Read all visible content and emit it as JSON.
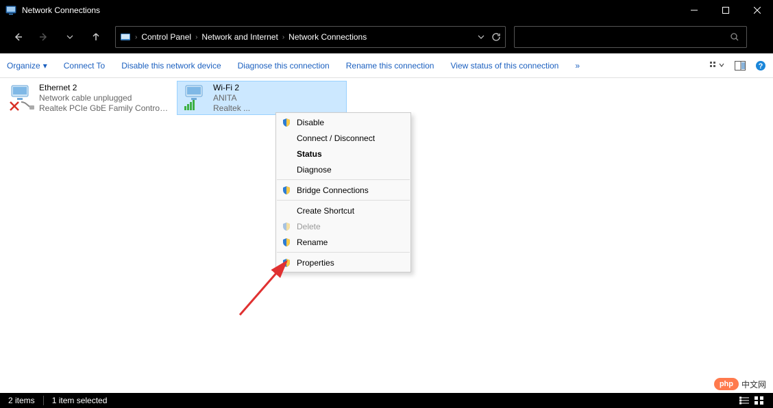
{
  "window": {
    "title": "Network Connections"
  },
  "breadcrumbs": [
    "Control Panel",
    "Network and Internet",
    "Network Connections"
  ],
  "toolbar": {
    "organize": "Organize",
    "items": [
      "Connect To",
      "Disable this network device",
      "Diagnose this connection",
      "Rename this connection",
      "View status of this connection"
    ],
    "overflow": "»"
  },
  "connections": [
    {
      "name": "Ethernet 2",
      "status": "Network cable unplugged",
      "device": "Realtek PCIe GbE Family Controller",
      "selected": false,
      "type": "ethernet"
    },
    {
      "name": "Wi-Fi 2",
      "status": "ANITA",
      "device": "Realtek ...",
      "selected": true,
      "type": "wifi"
    }
  ],
  "context_menu": [
    {
      "label": "Disable",
      "shield": true
    },
    {
      "label": "Connect / Disconnect"
    },
    {
      "label": "Status",
      "bold": true
    },
    {
      "label": "Diagnose"
    },
    {
      "sep": true
    },
    {
      "label": "Bridge Connections",
      "shield": true
    },
    {
      "sep": true
    },
    {
      "label": "Create Shortcut"
    },
    {
      "label": "Delete",
      "shield": true,
      "disabled": true
    },
    {
      "label": "Rename",
      "shield": true
    },
    {
      "sep": true
    },
    {
      "label": "Properties",
      "shield": true
    }
  ],
  "statusbar": {
    "count": "2 items",
    "selected": "1 item selected"
  },
  "watermark": {
    "badge": "php",
    "text": "中文网"
  }
}
